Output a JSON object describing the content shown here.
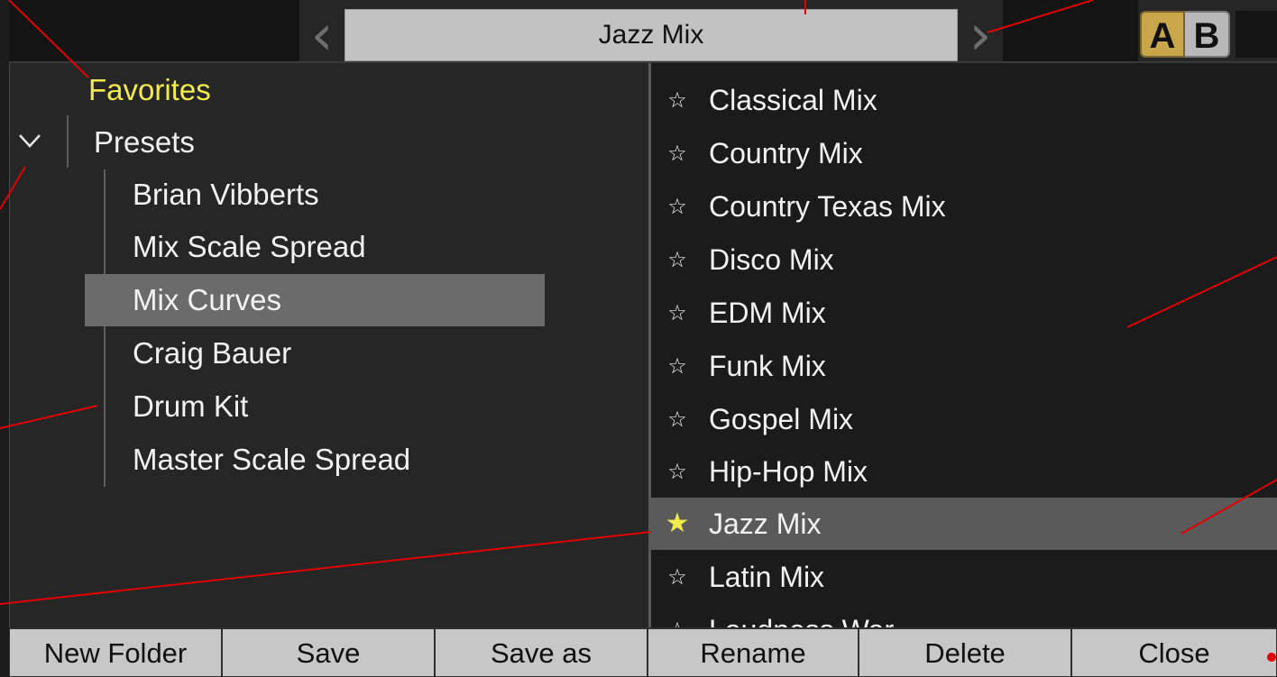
{
  "header": {
    "title": "Jazz Mix",
    "prev_icon": "‹",
    "next_icon": "›",
    "compare": {
      "a_label": "A",
      "b_label": "B",
      "active": "A"
    }
  },
  "browser": {
    "favorites_label": "Favorites",
    "presets_label": "Presets",
    "folders": [
      {
        "label": "Brian Vibberts"
      },
      {
        "label": "Mix Scale Spread"
      },
      {
        "label": "Mix Curves",
        "selected": true
      },
      {
        "label": "Craig Bauer"
      },
      {
        "label": "Drum Kit"
      },
      {
        "label": "Master Scale Spread"
      }
    ]
  },
  "preset_list": {
    "items": [
      {
        "label": "Classical Mix",
        "favorite": false
      },
      {
        "label": "Country Mix",
        "favorite": false
      },
      {
        "label": "Country Texas Mix",
        "favorite": false
      },
      {
        "label": "Disco Mix",
        "favorite": false
      },
      {
        "label": "EDM Mix",
        "favorite": false
      },
      {
        "label": "Funk Mix",
        "favorite": false
      },
      {
        "label": "Gospel Mix",
        "favorite": false
      },
      {
        "label": "Hip-Hop Mix",
        "favorite": false
      },
      {
        "label": "Jazz Mix",
        "favorite": true,
        "selected": true
      },
      {
        "label": "Latin Mix",
        "favorite": false
      },
      {
        "label": "Loudness War",
        "favorite": false
      }
    ],
    "star_empty": "☆",
    "star_filled": "★"
  },
  "bottom_bar": {
    "new_folder": "New Folder",
    "save": "Save",
    "save_as": "Save as",
    "rename": "Rename",
    "delete": "Delete",
    "close": "Close"
  },
  "colors": {
    "favorite_yellow": "#f3ea4c",
    "compare_a_gold": "#c9a64a",
    "annotation_red": "#e00000",
    "selection_gray": "#6b6b6b"
  }
}
